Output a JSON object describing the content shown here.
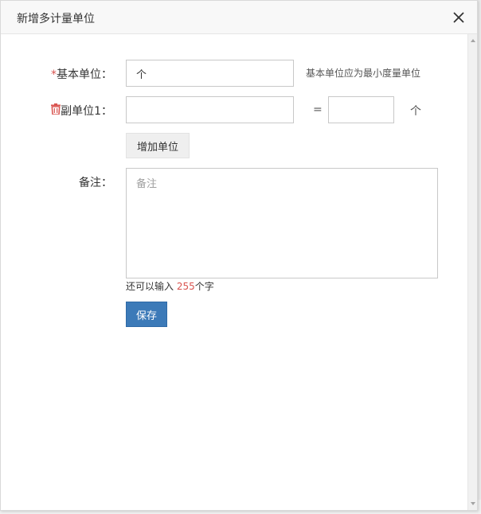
{
  "dialog": {
    "title": "新增多计量单位",
    "close_icon": "close-icon"
  },
  "base_unit": {
    "required_mark": "*",
    "label": "基本单位：",
    "value": "个",
    "hint": "基本单位应为最小度量单位"
  },
  "sub_unit": {
    "icon": "trash-icon",
    "label": "副单位1：",
    "value": "",
    "equals": "=",
    "quantity": "",
    "suffix": "个"
  },
  "add_unit_button": "增加单位",
  "remark": {
    "label": "备注：",
    "placeholder": "备注",
    "counter_prefix": "还可以输入 ",
    "counter_value": "255",
    "counter_suffix": "个字"
  },
  "save_button": "保存",
  "colors": {
    "accent": "#3c7ab8",
    "danger": "#d9534f"
  }
}
